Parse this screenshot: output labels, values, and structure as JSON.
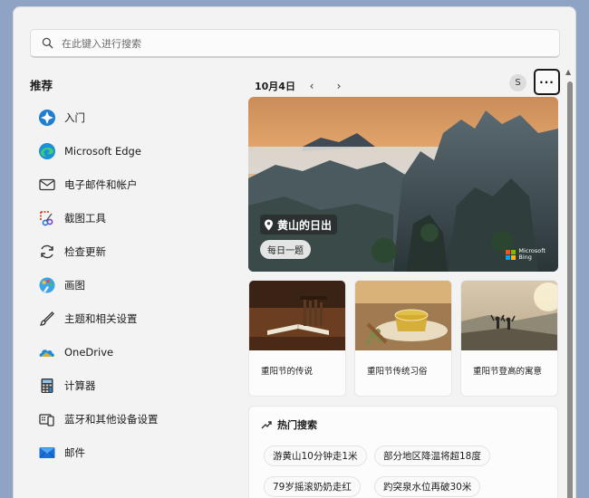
{
  "search": {
    "placeholder": "在此键入进行搜索"
  },
  "recommended": {
    "title": "推荐",
    "apps": [
      {
        "label": "入门",
        "icon": "get-started-icon"
      },
      {
        "label": "Microsoft Edge",
        "icon": "edge-icon"
      },
      {
        "label": "电子邮件和帐户",
        "icon": "mail-outline-icon"
      },
      {
        "label": "截图工具",
        "icon": "snipping-tool-icon"
      },
      {
        "label": "检查更新",
        "icon": "refresh-icon"
      },
      {
        "label": "画图",
        "icon": "paint-icon"
      },
      {
        "label": "主题和相关设置",
        "icon": "brush-icon"
      },
      {
        "label": "OneDrive",
        "icon": "onedrive-icon"
      },
      {
        "label": "计算器",
        "icon": "calculator-icon"
      },
      {
        "label": "蓝牙和其他设备设置",
        "icon": "devices-icon"
      },
      {
        "label": "邮件",
        "icon": "mail-app-icon"
      }
    ]
  },
  "feed": {
    "date": "10月4日",
    "avatar_letter": "S",
    "more_label": "···",
    "hero": {
      "title": "黄山的日出",
      "badge": "每日一题",
      "bing_brand_line1": "Microsoft",
      "bing_brand_line2": "Bing"
    },
    "cards": [
      {
        "caption": "重阳节的传说"
      },
      {
        "caption": "重阳节传统习俗"
      },
      {
        "caption": "重阳节登高的寓意"
      }
    ],
    "hot_searches": {
      "title": "热门搜索",
      "items": [
        "游黄山10分钟走1米",
        "部分地区降温将超18度",
        "79岁摇滚奶奶走红",
        "趵突泉水位再破30米"
      ]
    }
  },
  "colors": {
    "accent": "#0067c0",
    "panel": "#f3f3f3",
    "desktop": "#8fa4c4"
  }
}
